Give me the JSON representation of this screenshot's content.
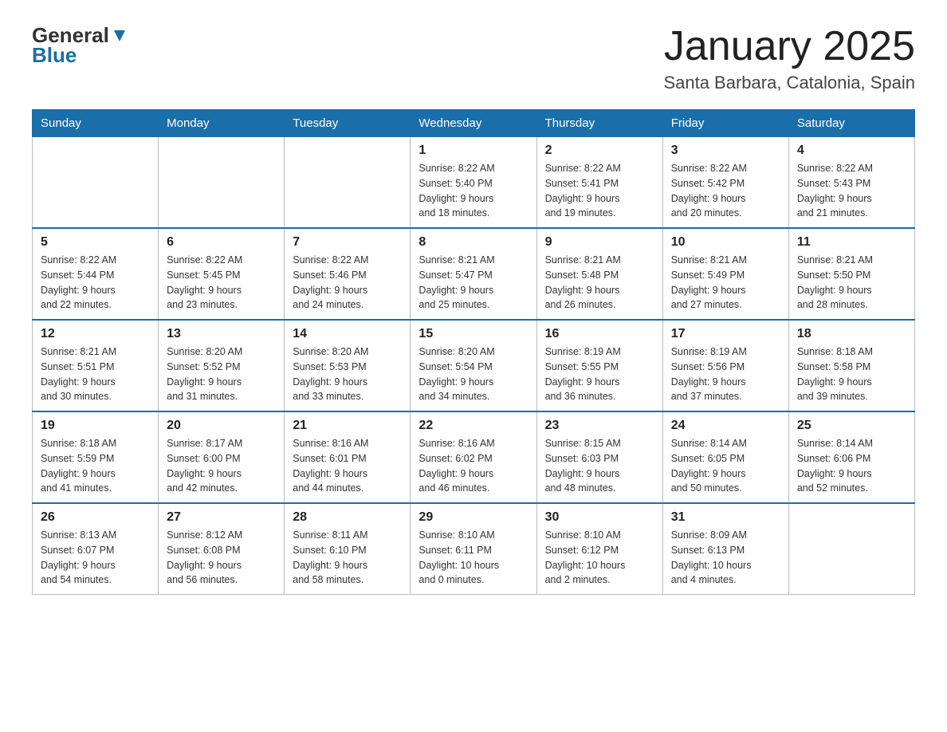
{
  "header": {
    "logo": {
      "general": "General",
      "blue": "Blue"
    },
    "title": "January 2025",
    "location": "Santa Barbara, Catalonia, Spain"
  },
  "days_of_week": [
    "Sunday",
    "Monday",
    "Tuesday",
    "Wednesday",
    "Thursday",
    "Friday",
    "Saturday"
  ],
  "weeks": [
    [
      {
        "day": "",
        "info": ""
      },
      {
        "day": "",
        "info": ""
      },
      {
        "day": "",
        "info": ""
      },
      {
        "day": "1",
        "info": "Sunrise: 8:22 AM\nSunset: 5:40 PM\nDaylight: 9 hours\nand 18 minutes."
      },
      {
        "day": "2",
        "info": "Sunrise: 8:22 AM\nSunset: 5:41 PM\nDaylight: 9 hours\nand 19 minutes."
      },
      {
        "day": "3",
        "info": "Sunrise: 8:22 AM\nSunset: 5:42 PM\nDaylight: 9 hours\nand 20 minutes."
      },
      {
        "day": "4",
        "info": "Sunrise: 8:22 AM\nSunset: 5:43 PM\nDaylight: 9 hours\nand 21 minutes."
      }
    ],
    [
      {
        "day": "5",
        "info": "Sunrise: 8:22 AM\nSunset: 5:44 PM\nDaylight: 9 hours\nand 22 minutes."
      },
      {
        "day": "6",
        "info": "Sunrise: 8:22 AM\nSunset: 5:45 PM\nDaylight: 9 hours\nand 23 minutes."
      },
      {
        "day": "7",
        "info": "Sunrise: 8:22 AM\nSunset: 5:46 PM\nDaylight: 9 hours\nand 24 minutes."
      },
      {
        "day": "8",
        "info": "Sunrise: 8:21 AM\nSunset: 5:47 PM\nDaylight: 9 hours\nand 25 minutes."
      },
      {
        "day": "9",
        "info": "Sunrise: 8:21 AM\nSunset: 5:48 PM\nDaylight: 9 hours\nand 26 minutes."
      },
      {
        "day": "10",
        "info": "Sunrise: 8:21 AM\nSunset: 5:49 PM\nDaylight: 9 hours\nand 27 minutes."
      },
      {
        "day": "11",
        "info": "Sunrise: 8:21 AM\nSunset: 5:50 PM\nDaylight: 9 hours\nand 28 minutes."
      }
    ],
    [
      {
        "day": "12",
        "info": "Sunrise: 8:21 AM\nSunset: 5:51 PM\nDaylight: 9 hours\nand 30 minutes."
      },
      {
        "day": "13",
        "info": "Sunrise: 8:20 AM\nSunset: 5:52 PM\nDaylight: 9 hours\nand 31 minutes."
      },
      {
        "day": "14",
        "info": "Sunrise: 8:20 AM\nSunset: 5:53 PM\nDaylight: 9 hours\nand 33 minutes."
      },
      {
        "day": "15",
        "info": "Sunrise: 8:20 AM\nSunset: 5:54 PM\nDaylight: 9 hours\nand 34 minutes."
      },
      {
        "day": "16",
        "info": "Sunrise: 8:19 AM\nSunset: 5:55 PM\nDaylight: 9 hours\nand 36 minutes."
      },
      {
        "day": "17",
        "info": "Sunrise: 8:19 AM\nSunset: 5:56 PM\nDaylight: 9 hours\nand 37 minutes."
      },
      {
        "day": "18",
        "info": "Sunrise: 8:18 AM\nSunset: 5:58 PM\nDaylight: 9 hours\nand 39 minutes."
      }
    ],
    [
      {
        "day": "19",
        "info": "Sunrise: 8:18 AM\nSunset: 5:59 PM\nDaylight: 9 hours\nand 41 minutes."
      },
      {
        "day": "20",
        "info": "Sunrise: 8:17 AM\nSunset: 6:00 PM\nDaylight: 9 hours\nand 42 minutes."
      },
      {
        "day": "21",
        "info": "Sunrise: 8:16 AM\nSunset: 6:01 PM\nDaylight: 9 hours\nand 44 minutes."
      },
      {
        "day": "22",
        "info": "Sunrise: 8:16 AM\nSunset: 6:02 PM\nDaylight: 9 hours\nand 46 minutes."
      },
      {
        "day": "23",
        "info": "Sunrise: 8:15 AM\nSunset: 6:03 PM\nDaylight: 9 hours\nand 48 minutes."
      },
      {
        "day": "24",
        "info": "Sunrise: 8:14 AM\nSunset: 6:05 PM\nDaylight: 9 hours\nand 50 minutes."
      },
      {
        "day": "25",
        "info": "Sunrise: 8:14 AM\nSunset: 6:06 PM\nDaylight: 9 hours\nand 52 minutes."
      }
    ],
    [
      {
        "day": "26",
        "info": "Sunrise: 8:13 AM\nSunset: 6:07 PM\nDaylight: 9 hours\nand 54 minutes."
      },
      {
        "day": "27",
        "info": "Sunrise: 8:12 AM\nSunset: 6:08 PM\nDaylight: 9 hours\nand 56 minutes."
      },
      {
        "day": "28",
        "info": "Sunrise: 8:11 AM\nSunset: 6:10 PM\nDaylight: 9 hours\nand 58 minutes."
      },
      {
        "day": "29",
        "info": "Sunrise: 8:10 AM\nSunset: 6:11 PM\nDaylight: 10 hours\nand 0 minutes."
      },
      {
        "day": "30",
        "info": "Sunrise: 8:10 AM\nSunset: 6:12 PM\nDaylight: 10 hours\nand 2 minutes."
      },
      {
        "day": "31",
        "info": "Sunrise: 8:09 AM\nSunset: 6:13 PM\nDaylight: 10 hours\nand 4 minutes."
      },
      {
        "day": "",
        "info": ""
      }
    ]
  ]
}
